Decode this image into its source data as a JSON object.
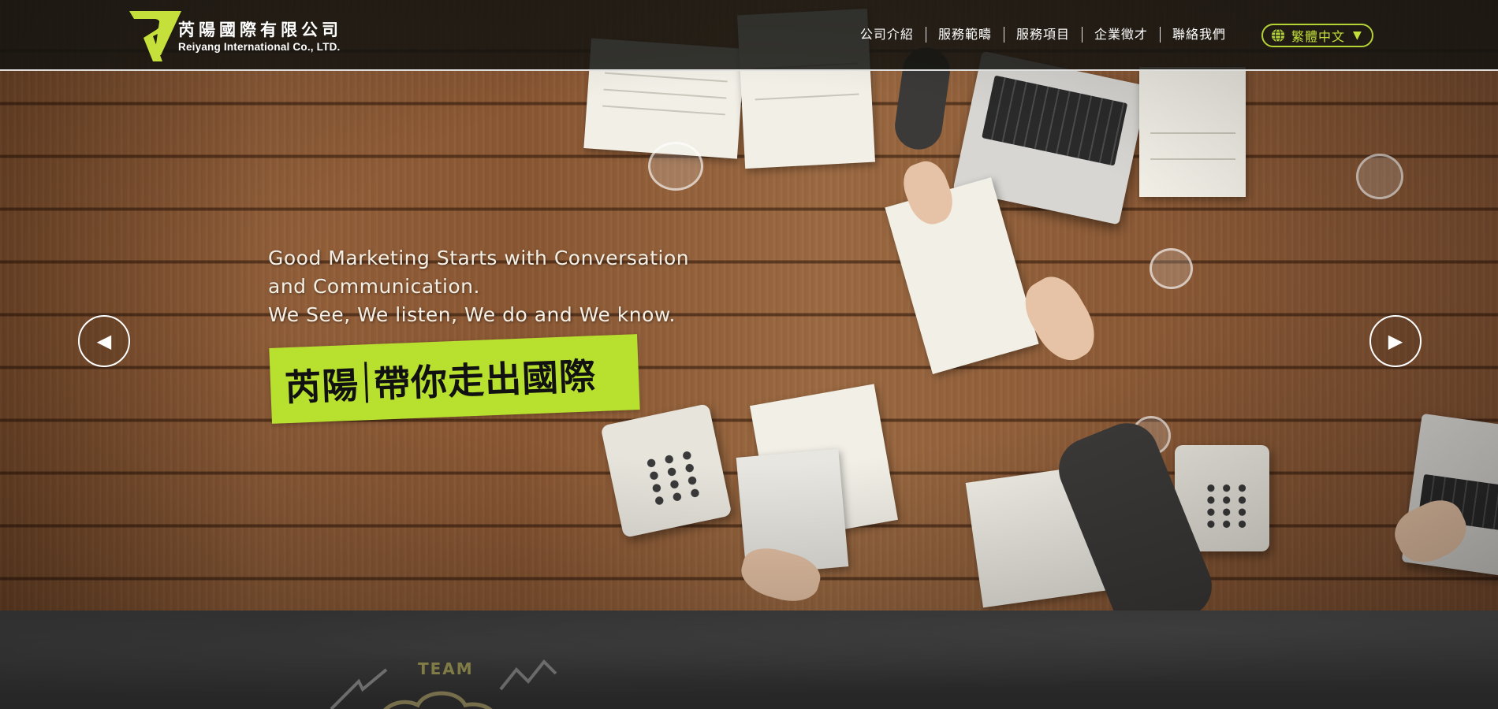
{
  "header": {
    "logo": {
      "name_cn": "芮陽國際有限公司",
      "name_en": "Reiyang International Co., LTD.",
      "mark_color": "#c5e03a"
    },
    "nav": [
      {
        "label": "公司介紹"
      },
      {
        "label": "服務範疇"
      },
      {
        "label": "服務項目"
      },
      {
        "label": "企業徵才"
      },
      {
        "label": "聯絡我們"
      }
    ],
    "language": {
      "label": "繁體中文",
      "icon": "globe-icon",
      "caret": "▼",
      "accent": "#b5d334"
    }
  },
  "hero": {
    "tagline_lines": [
      "Good Marketing Starts with Conversation",
      "and Communication.",
      "We See, We listen, We do and We know."
    ],
    "slogan_left": "芮陽",
    "slogan_right": "帶你走出國際",
    "slogan_bg": "#b8e02e",
    "prev_arrow": "◀",
    "next_arrow": "▶"
  },
  "section2": {
    "chalk_word": "TEAM"
  }
}
